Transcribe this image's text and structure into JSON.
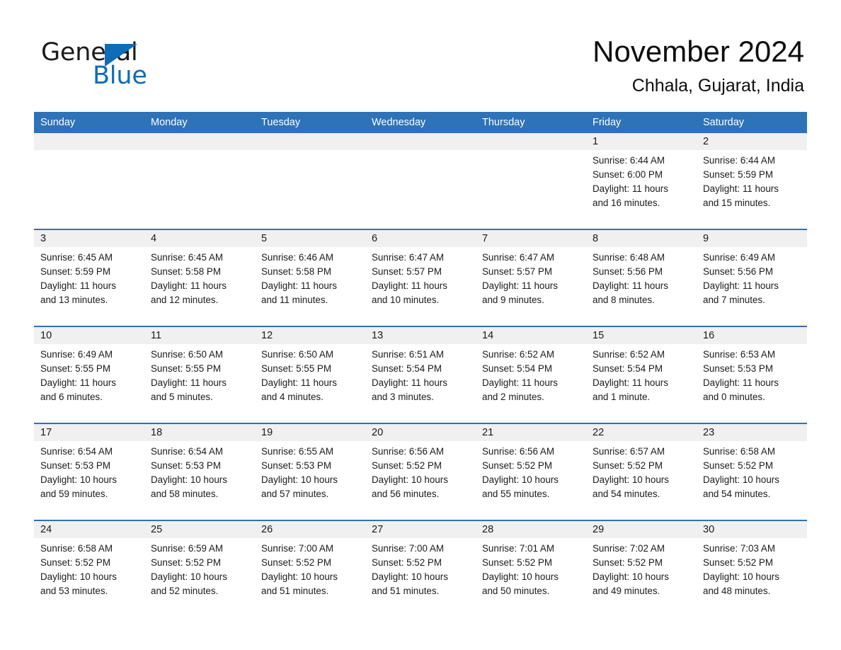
{
  "logo": {
    "word_one": "General",
    "word_two": "Blue",
    "triangle_color": "#0f6cb6",
    "text_color": "#1b1b1b"
  },
  "header": {
    "title": "November 2024",
    "location": "Chhala, Gujarat, India"
  },
  "theme": {
    "header_blue": "#2e72b8",
    "band_gray": "#f0f0f0",
    "text": "#1a1a1a",
    "logo_blue": "#0f6cb6"
  },
  "weekdays": [
    "Sunday",
    "Monday",
    "Tuesday",
    "Wednesday",
    "Thursday",
    "Friday",
    "Saturday"
  ],
  "weeks": [
    [
      {
        "date": "",
        "lines": []
      },
      {
        "date": "",
        "lines": []
      },
      {
        "date": "",
        "lines": []
      },
      {
        "date": "",
        "lines": []
      },
      {
        "date": "",
        "lines": []
      },
      {
        "date": "1",
        "lines": [
          "Sunrise: 6:44 AM",
          "Sunset: 6:00 PM",
          "Daylight: 11 hours",
          "and 16 minutes."
        ]
      },
      {
        "date": "2",
        "lines": [
          "Sunrise: 6:44 AM",
          "Sunset: 5:59 PM",
          "Daylight: 11 hours",
          "and 15 minutes."
        ]
      }
    ],
    [
      {
        "date": "3",
        "lines": [
          "Sunrise: 6:45 AM",
          "Sunset: 5:59 PM",
          "Daylight: 11 hours",
          "and 13 minutes."
        ]
      },
      {
        "date": "4",
        "lines": [
          "Sunrise: 6:45 AM",
          "Sunset: 5:58 PM",
          "Daylight: 11 hours",
          "and 12 minutes."
        ]
      },
      {
        "date": "5",
        "lines": [
          "Sunrise: 6:46 AM",
          "Sunset: 5:58 PM",
          "Daylight: 11 hours",
          "and 11 minutes."
        ]
      },
      {
        "date": "6",
        "lines": [
          "Sunrise: 6:47 AM",
          "Sunset: 5:57 PM",
          "Daylight: 11 hours",
          "and 10 minutes."
        ]
      },
      {
        "date": "7",
        "lines": [
          "Sunrise: 6:47 AM",
          "Sunset: 5:57 PM",
          "Daylight: 11 hours",
          "and 9 minutes."
        ]
      },
      {
        "date": "8",
        "lines": [
          "Sunrise: 6:48 AM",
          "Sunset: 5:56 PM",
          "Daylight: 11 hours",
          "and 8 minutes."
        ]
      },
      {
        "date": "9",
        "lines": [
          "Sunrise: 6:49 AM",
          "Sunset: 5:56 PM",
          "Daylight: 11 hours",
          "and 7 minutes."
        ]
      }
    ],
    [
      {
        "date": "10",
        "lines": [
          "Sunrise: 6:49 AM",
          "Sunset: 5:55 PM",
          "Daylight: 11 hours",
          "and 6 minutes."
        ]
      },
      {
        "date": "11",
        "lines": [
          "Sunrise: 6:50 AM",
          "Sunset: 5:55 PM",
          "Daylight: 11 hours",
          "and 5 minutes."
        ]
      },
      {
        "date": "12",
        "lines": [
          "Sunrise: 6:50 AM",
          "Sunset: 5:55 PM",
          "Daylight: 11 hours",
          "and 4 minutes."
        ]
      },
      {
        "date": "13",
        "lines": [
          "Sunrise: 6:51 AM",
          "Sunset: 5:54 PM",
          "Daylight: 11 hours",
          "and 3 minutes."
        ]
      },
      {
        "date": "14",
        "lines": [
          "Sunrise: 6:52 AM",
          "Sunset: 5:54 PM",
          "Daylight: 11 hours",
          "and 2 minutes."
        ]
      },
      {
        "date": "15",
        "lines": [
          "Sunrise: 6:52 AM",
          "Sunset: 5:54 PM",
          "Daylight: 11 hours",
          "and 1 minute."
        ]
      },
      {
        "date": "16",
        "lines": [
          "Sunrise: 6:53 AM",
          "Sunset: 5:53 PM",
          "Daylight: 11 hours",
          "and 0 minutes."
        ]
      }
    ],
    [
      {
        "date": "17",
        "lines": [
          "Sunrise: 6:54 AM",
          "Sunset: 5:53 PM",
          "Daylight: 10 hours",
          "and 59 minutes."
        ]
      },
      {
        "date": "18",
        "lines": [
          "Sunrise: 6:54 AM",
          "Sunset: 5:53 PM",
          "Daylight: 10 hours",
          "and 58 minutes."
        ]
      },
      {
        "date": "19",
        "lines": [
          "Sunrise: 6:55 AM",
          "Sunset: 5:53 PM",
          "Daylight: 10 hours",
          "and 57 minutes."
        ]
      },
      {
        "date": "20",
        "lines": [
          "Sunrise: 6:56 AM",
          "Sunset: 5:52 PM",
          "Daylight: 10 hours",
          "and 56 minutes."
        ]
      },
      {
        "date": "21",
        "lines": [
          "Sunrise: 6:56 AM",
          "Sunset: 5:52 PM",
          "Daylight: 10 hours",
          "and 55 minutes."
        ]
      },
      {
        "date": "22",
        "lines": [
          "Sunrise: 6:57 AM",
          "Sunset: 5:52 PM",
          "Daylight: 10 hours",
          "and 54 minutes."
        ]
      },
      {
        "date": "23",
        "lines": [
          "Sunrise: 6:58 AM",
          "Sunset: 5:52 PM",
          "Daylight: 10 hours",
          "and 54 minutes."
        ]
      }
    ],
    [
      {
        "date": "24",
        "lines": [
          "Sunrise: 6:58 AM",
          "Sunset: 5:52 PM",
          "Daylight: 10 hours",
          "and 53 minutes."
        ]
      },
      {
        "date": "25",
        "lines": [
          "Sunrise: 6:59 AM",
          "Sunset: 5:52 PM",
          "Daylight: 10 hours",
          "and 52 minutes."
        ]
      },
      {
        "date": "26",
        "lines": [
          "Sunrise: 7:00 AM",
          "Sunset: 5:52 PM",
          "Daylight: 10 hours",
          "and 51 minutes."
        ]
      },
      {
        "date": "27",
        "lines": [
          "Sunrise: 7:00 AM",
          "Sunset: 5:52 PM",
          "Daylight: 10 hours",
          "and 51 minutes."
        ]
      },
      {
        "date": "28",
        "lines": [
          "Sunrise: 7:01 AM",
          "Sunset: 5:52 PM",
          "Daylight: 10 hours",
          "and 50 minutes."
        ]
      },
      {
        "date": "29",
        "lines": [
          "Sunrise: 7:02 AM",
          "Sunset: 5:52 PM",
          "Daylight: 10 hours",
          "and 49 minutes."
        ]
      },
      {
        "date": "30",
        "lines": [
          "Sunrise: 7:03 AM",
          "Sunset: 5:52 PM",
          "Daylight: 10 hours",
          "and 48 minutes."
        ]
      }
    ]
  ]
}
